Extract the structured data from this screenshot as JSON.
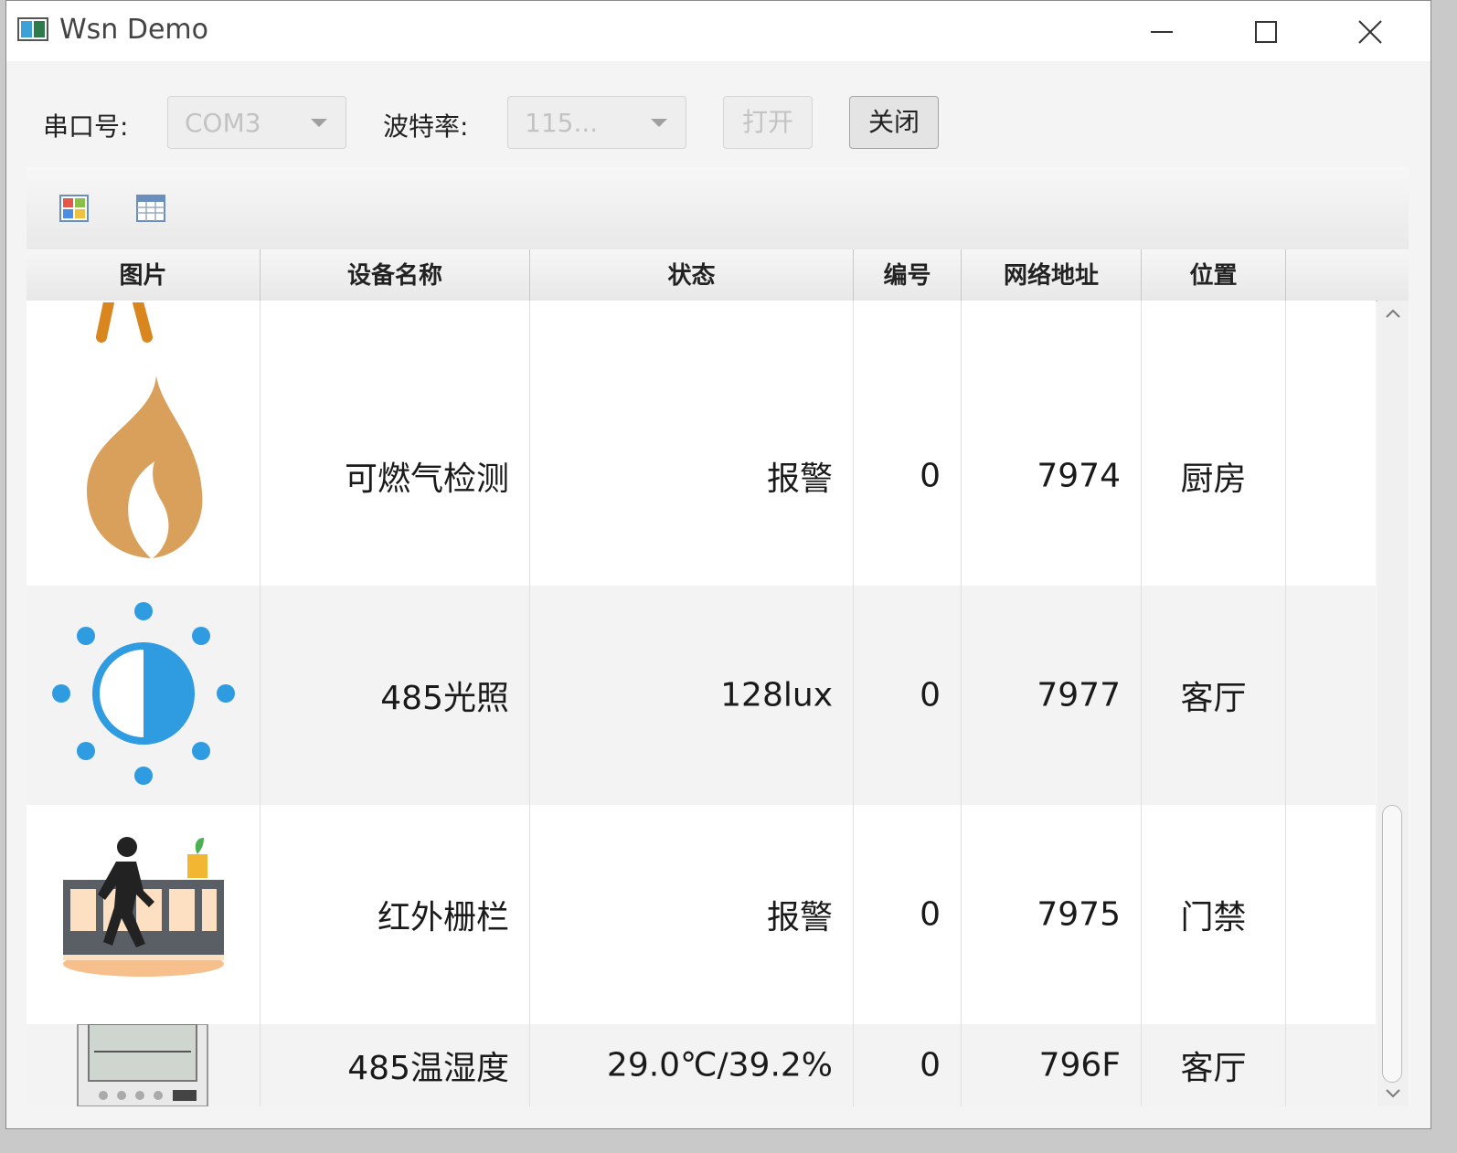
{
  "window": {
    "title": "Wsn Demo"
  },
  "toolbar": {
    "port_label": "串口号:",
    "port_value": "COM3",
    "baud_label": "波特率:",
    "baud_value": "115...",
    "open_label": "打开",
    "close_label": "关闭"
  },
  "table": {
    "columns": [
      "图片",
      "设备名称",
      "状态",
      "编号",
      "网络地址",
      "位置"
    ],
    "rows": [
      {
        "name": "",
        "status": "",
        "id": "",
        "address": "",
        "location": "",
        "icon": "partial-icon"
      },
      {
        "name": "可燃气检测",
        "status": "报警",
        "id": "0",
        "address": "7974",
        "location": "厨房",
        "icon": "flame-icon"
      },
      {
        "name": "485光照",
        "status": "128lux",
        "id": "0",
        "address": "7977",
        "location": "客厅",
        "icon": "light-sensor-icon"
      },
      {
        "name": "红外栅栏",
        "status": "报警",
        "id": "0",
        "address": "7975",
        "location": "门禁",
        "icon": "infrared-fence-icon"
      },
      {
        "name": "485温湿度",
        "status": "29.0℃/39.2%",
        "id": "0",
        "address": "796F",
        "location": "客厅",
        "icon": "thermo-hygrometer-icon"
      }
    ]
  },
  "colors": {
    "flame": "#d9a05b",
    "light": "#2f9be0",
    "fence": "#f08a2c"
  }
}
